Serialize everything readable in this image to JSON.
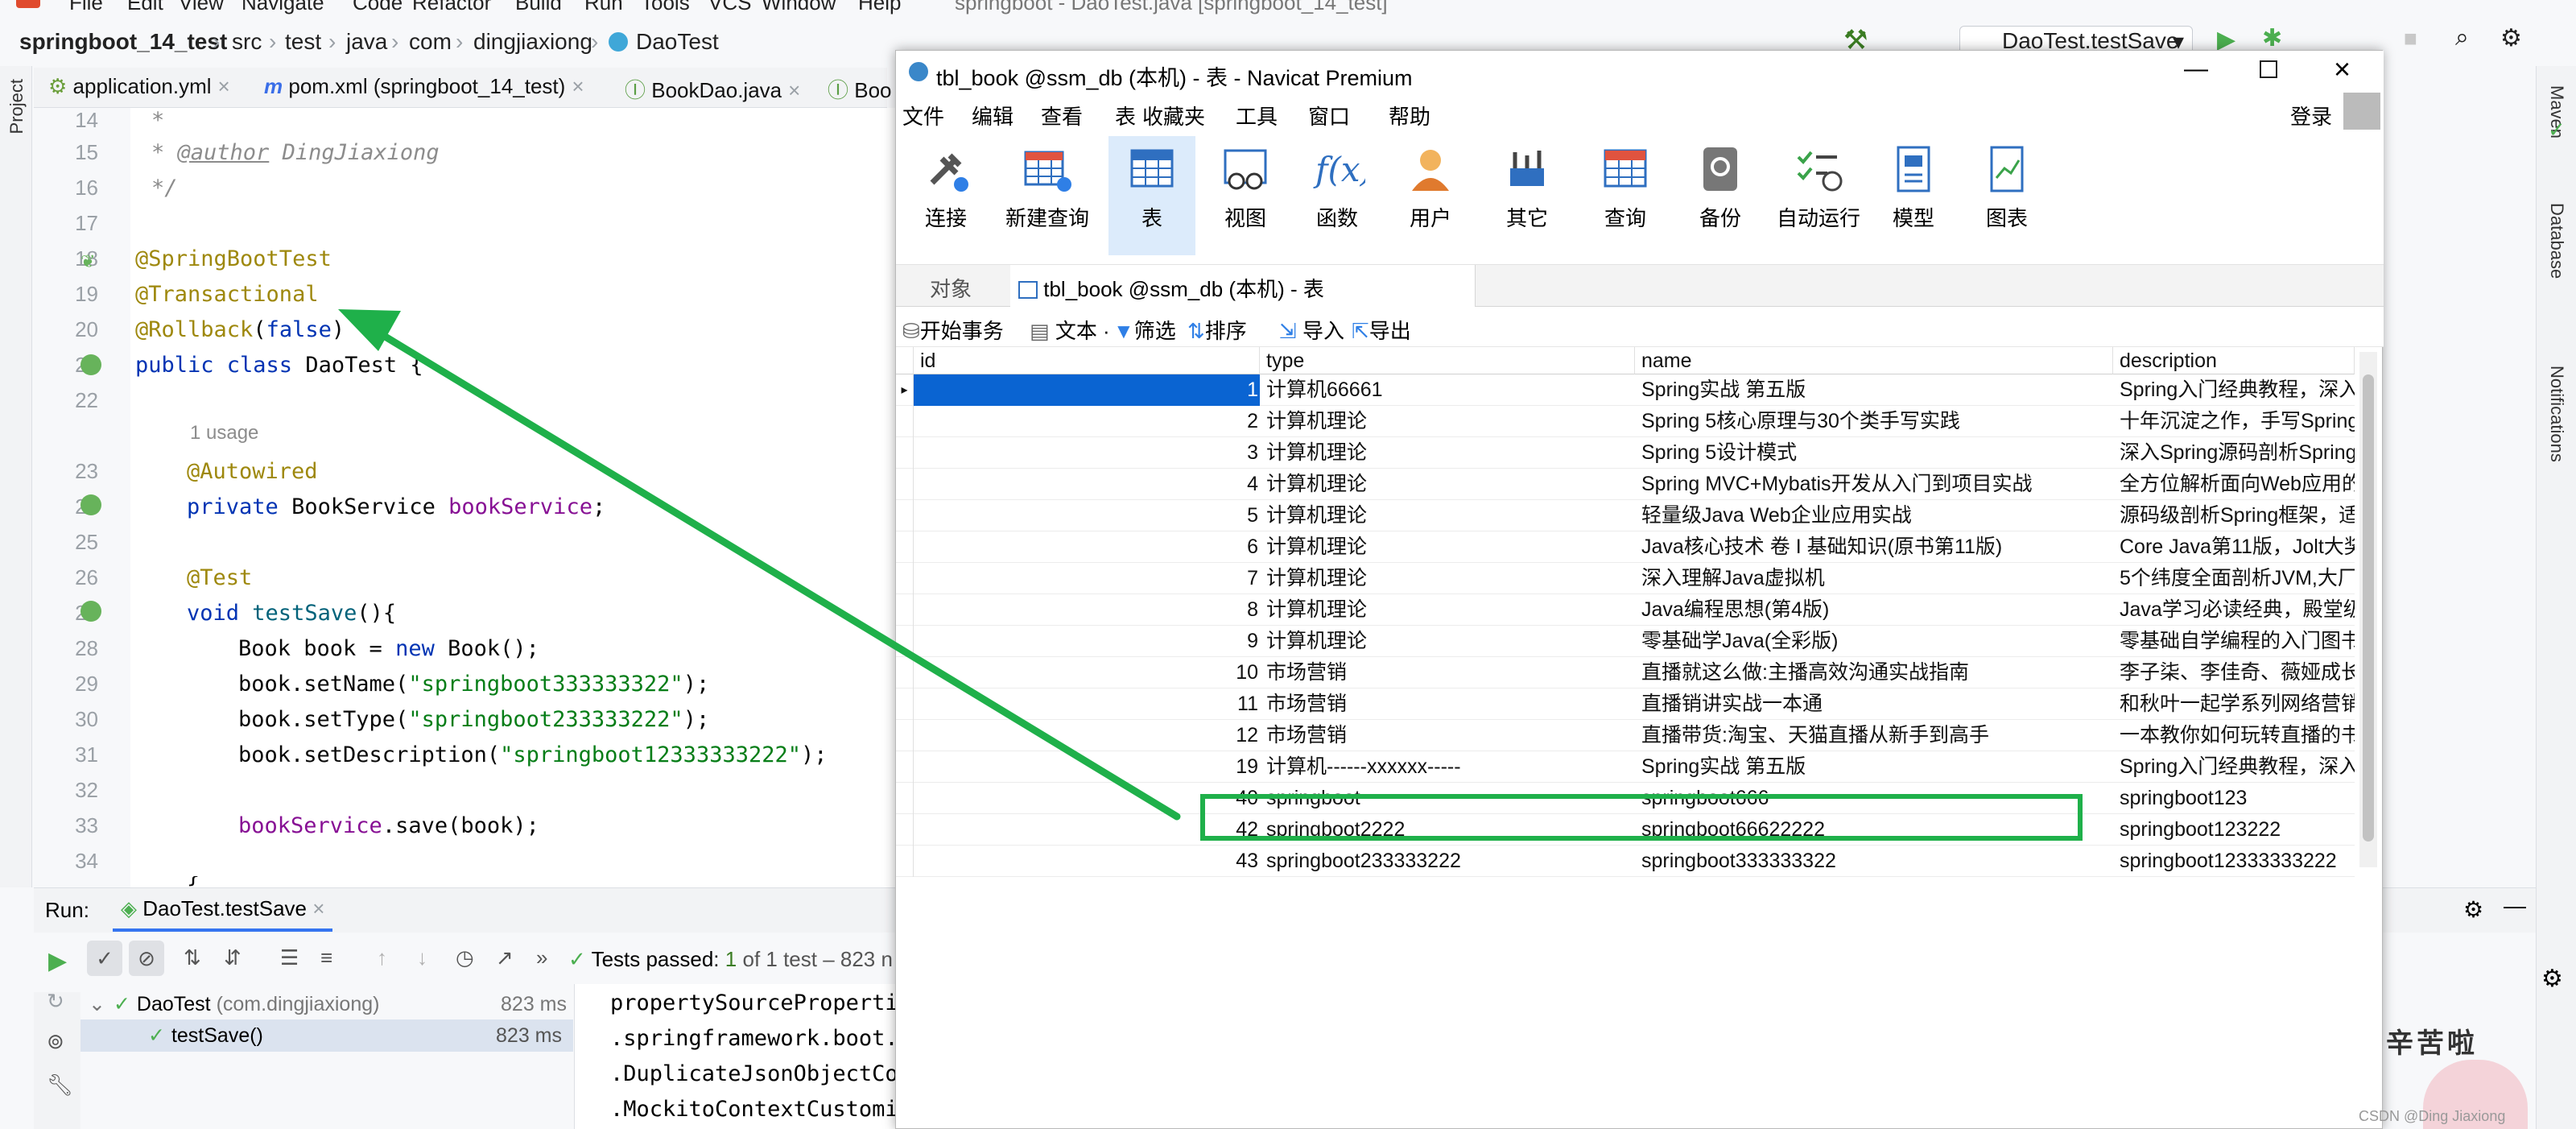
{
  "ide": {
    "menu": [
      "File",
      "Edit",
      "View",
      "Navigate",
      "Code",
      "Refactor",
      "Build",
      "Run",
      "Tools",
      "VCS",
      "Window",
      "Help"
    ],
    "window_title": "springboot - DaoTest.java [springboot_14_test]",
    "breadcrumbs": [
      "springboot_14_test",
      "src",
      "test",
      "java",
      "com",
      "dingjiaxiong",
      "DaoTest"
    ],
    "run_config": "DaoTest.testSave",
    "editor_tabs": [
      {
        "label": "application.yml"
      },
      {
        "label": "pom.xml (springboot_14_test)"
      },
      {
        "label": "BookDao.java"
      },
      {
        "label": "Boo"
      }
    ],
    "left_strip_label": "Project",
    "right_strip_labels": [
      "Maven",
      "Database",
      "Notifications"
    ],
    "line_numbers": [
      "14",
      "15",
      "16",
      "17",
      "18",
      "19",
      "20",
      "21",
      "22",
      "",
      "23",
      "24",
      "25",
      "26",
      "27",
      "28",
      "29",
      "30",
      "31",
      "32",
      "33",
      "34"
    ],
    "code": {
      "l14": "*",
      "l15_tag": "@author",
      "l15_name": "DingJiaxiong",
      "l16": "*/",
      "l18": "@SpringBootTest",
      "l19": "@Transactional",
      "l20_anno": "@Rollback",
      "l20_arg": "false",
      "l21_kw": "public class",
      "l21_name": "DaoTest {",
      "usage_hint": "1 usage",
      "l23": "@Autowired",
      "l24_kw": "private",
      "l24_type": "BookService",
      "l24_field": "bookService",
      "l26": "@Test",
      "l27_kw": "void",
      "l27_fn": "testSave",
      "l28_a": "Book book = ",
      "l28_kw": "new",
      "l28_b": " Book();",
      "l29_a": "book.setName(",
      "l29_str": "\"springboot333333322\"",
      "l30_a": "book.setType(",
      "l30_str": "\"springboot233333222\"",
      "l31_a": "book.setDescription(",
      "l31_str": "\"springboot12333333222\"",
      "l33_field": "bookService",
      "l33_b": ".save(book);",
      "l35": "}"
    },
    "run": {
      "label": "Run:",
      "tab": "DaoTest.testSave",
      "status_prefix": "Tests passed:",
      "status_count": "1",
      "status_suffix": "of 1 test – 823 n",
      "tree": [
        {
          "name": "DaoTest",
          "pkg": "(com.dingjiaxiong)",
          "time": "823 ms"
        },
        {
          "name": "testSave()",
          "pkg": "",
          "time": "823 ms"
        }
      ],
      "console": [
        "propertySourcePropertie",
        ".springframework.boot.",
        ".DuplicateJsonObjectCon",
        ".MockitoContextCustomi"
      ]
    }
  },
  "navicat": {
    "title": "tbl_book @ssm_db (本机) - 表 - Navicat Premium",
    "menu": [
      "文件",
      "编辑",
      "查看",
      "表",
      "收藏夹",
      "工具",
      "窗口",
      "帮助"
    ],
    "login": "登录",
    "tools": [
      "连接",
      "新建查询",
      "表",
      "视图",
      "函数",
      "用户",
      "其它",
      "查询",
      "备份",
      "自动运行",
      "模型",
      "图表"
    ],
    "tabs": {
      "objects": "对象",
      "active": "tbl_book @ssm_db (本机) - 表"
    },
    "subtools": [
      "开始事务",
      "文本",
      "筛选",
      "排序",
      "导入",
      "导出"
    ],
    "columns": [
      "id",
      "type",
      "name",
      "description"
    ],
    "rows": [
      {
        "id": "1",
        "type": "计算机66661",
        "name": "Spring实战 第五版",
        "description": "Spring入门经典教程，深入"
      },
      {
        "id": "2",
        "type": "计算机理论",
        "name": "Spring 5核心原理与30个类手写实践",
        "description": "十年沉淀之作，手写Spring"
      },
      {
        "id": "3",
        "type": "计算机理论",
        "name": "Spring 5设计模式",
        "description": "深入Spring源码剖析Spring"
      },
      {
        "id": "4",
        "type": "计算机理论",
        "name": "Spring MVC+Mybatis开发从入门到项目实战",
        "description": "全方位解析面向Web应用的"
      },
      {
        "id": "5",
        "type": "计算机理论",
        "name": "轻量级Java Web企业应用实战",
        "description": "源码级剖析Spring框架，适"
      },
      {
        "id": "6",
        "type": "计算机理论",
        "name": "Java核心技术 卷 I 基础知识(原书第11版)",
        "description": "Core Java第11版，Jolt大奖"
      },
      {
        "id": "7",
        "type": "计算机理论",
        "name": "深入理解Java虚拟机",
        "description": "5个纬度全面剖析JVM,大厂"
      },
      {
        "id": "8",
        "type": "计算机理论",
        "name": "Java编程思想(第4版)",
        "description": "Java学习必读经典，殿堂级"
      },
      {
        "id": "9",
        "type": "计算机理论",
        "name": "零基础学Java(全彩版)",
        "description": "零基础自学编程的入门图书"
      },
      {
        "id": "10",
        "type": "市场营销",
        "name": "直播就这么做:主播高效沟通实战指南",
        "description": "李子柒、李佳奇、薇娅成长"
      },
      {
        "id": "11",
        "type": "市场营销",
        "name": "直播销讲实战一本通",
        "description": "和秋叶一起学系列网络营销"
      },
      {
        "id": "12",
        "type": "市场营销",
        "name": "直播带货:淘宝、天猫直播从新手到高手",
        "description": "一本教你如何玩转直播的书"
      },
      {
        "id": "19",
        "type": "计算机------xxxxxx-----",
        "name": "Spring实战 第五版",
        "description": "Spring入门经典教程，深入"
      },
      {
        "id": "40",
        "type": "springboot",
        "name": "springboot666",
        "description": "springboot123"
      },
      {
        "id": "42",
        "type": "springboot2222",
        "name": "springboot66622222",
        "description": "springboot123222"
      },
      {
        "id": "43",
        "type": "springboot233333222",
        "name": "springboot333333322",
        "description": "springboot12333333222"
      }
    ]
  },
  "sticker": {
    "text": "辛苦啦",
    "watermark": "CSDN @Ding Jiaxiong"
  },
  "colors": {
    "highlight": "#1fb04a",
    "selected_row": "#0a64d2",
    "keyword": "#0033b3",
    "string": "#067d17",
    "annotation": "#9e880d"
  }
}
